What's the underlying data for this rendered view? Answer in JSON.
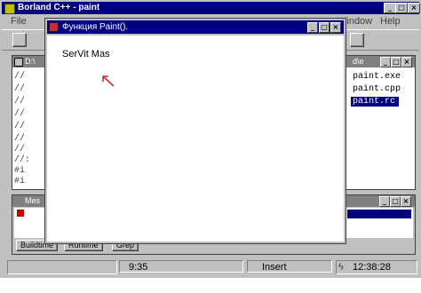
{
  "ide": {
    "title": "Borland C++ - paint",
    "menu": {
      "file": "File",
      "window": "Window",
      "help": "Help"
    },
    "source_window": {
      "title": "D:\\",
      "lines": [
        "//",
        "//",
        "//",
        "//",
        "//",
        "//",
        "//",
        "//:",
        "#i",
        "#i"
      ]
    },
    "project_window": {
      "title": "d\\e",
      "files": [
        "paint.exe",
        "paint.cpp",
        "paint.rc"
      ]
    },
    "message_window": {
      "title": "Mes",
      "tabs": [
        "Buildtime",
        "Runtime",
        "Grep"
      ]
    },
    "statusbar": {
      "position": "9:35",
      "mode": "Insert",
      "time": "12:38:28"
    }
  },
  "dialog": {
    "title": "Функция Paint().",
    "content_text": "SerVit Mas"
  },
  "colors": {
    "titlebar_active": "#000080",
    "titlebar_inactive": "#808080",
    "face": "#c0c0c0",
    "arrow": "#c03030"
  },
  "icons": [
    "app-icon",
    "minimize-icon",
    "maximize-icon",
    "close-icon",
    "arrow-cursor-icon",
    "lightning-icon"
  ]
}
